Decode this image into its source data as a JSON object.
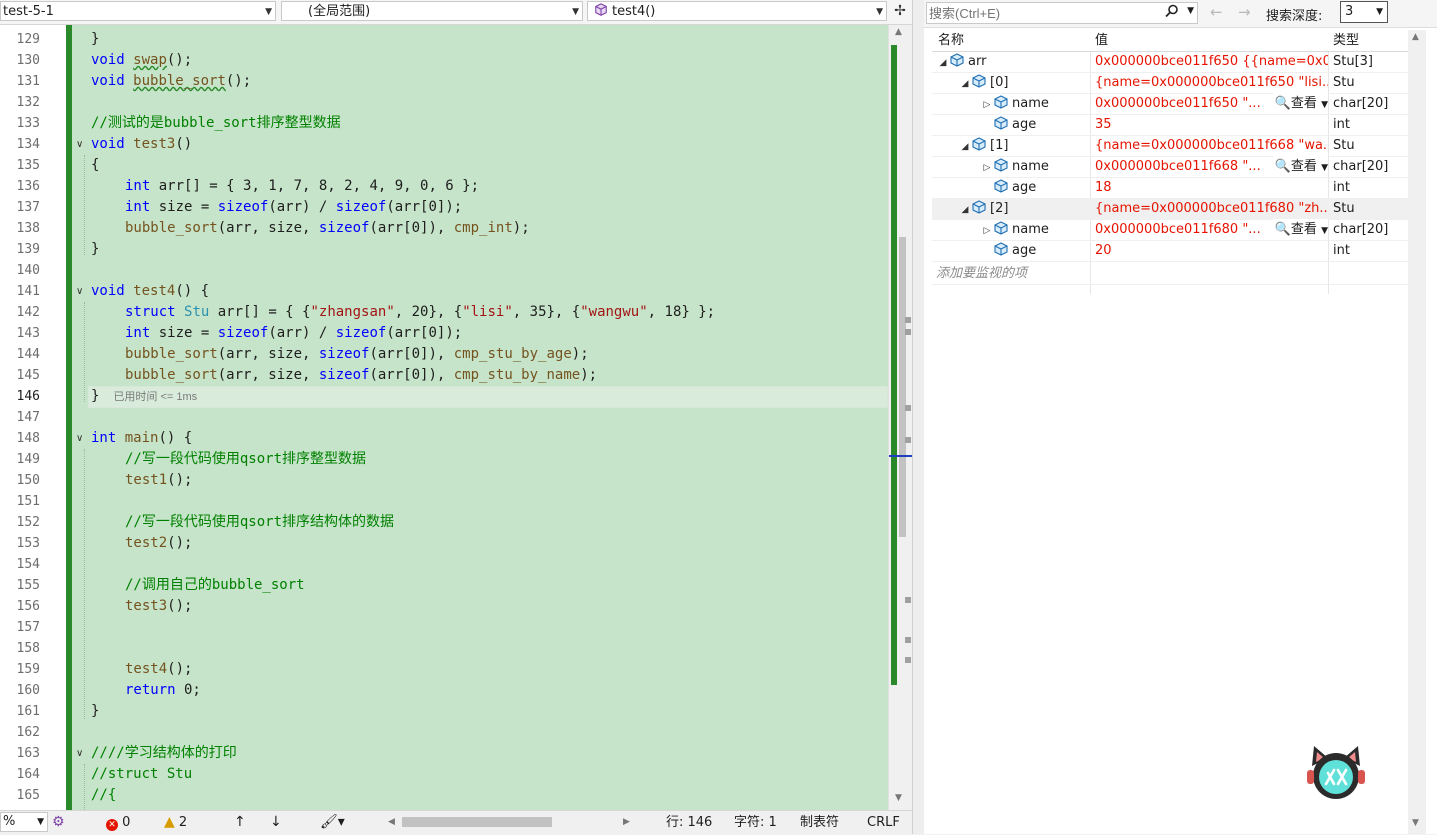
{
  "topbar": {
    "project": "test-5-1",
    "scope": "(全局范围)",
    "function": "test4()"
  },
  "editor": {
    "lines": [
      {
        "n": "129"
      },
      {
        "n": "130"
      },
      {
        "n": "131"
      },
      {
        "n": "132"
      },
      {
        "n": "133"
      },
      {
        "n": "134"
      },
      {
        "n": "135"
      },
      {
        "n": "136"
      },
      {
        "n": "137"
      },
      {
        "n": "138"
      },
      {
        "n": "139"
      },
      {
        "n": "140"
      },
      {
        "n": "141"
      },
      {
        "n": "142"
      },
      {
        "n": "143"
      },
      {
        "n": "144"
      },
      {
        "n": "145"
      },
      {
        "n": "146"
      },
      {
        "n": "147"
      },
      {
        "n": "148"
      },
      {
        "n": "149"
      },
      {
        "n": "150"
      },
      {
        "n": "151"
      },
      {
        "n": "152"
      },
      {
        "n": "153"
      },
      {
        "n": "154"
      },
      {
        "n": "155"
      },
      {
        "n": "156"
      },
      {
        "n": "157"
      },
      {
        "n": "158"
      },
      {
        "n": "159"
      },
      {
        "n": "160"
      },
      {
        "n": "161"
      },
      {
        "n": "162"
      },
      {
        "n": "163"
      },
      {
        "n": "164"
      },
      {
        "n": "165"
      }
    ],
    "current_line": "146",
    "elapsed_hint": "已用时间 <= 1ms",
    "code": {
      "l129": "}",
      "l130_kw": "void",
      "l130_fn": "swap",
      "l130_rest": "();",
      "l131_kw": "void",
      "l131_fn": "bubble_sort",
      "l131_rest": "();",
      "l133": "//测试的是bubble_sort排序整型数据",
      "l134_kw": "void",
      "l134_fn": "test3",
      "l134_rest": "()",
      "l135": "{",
      "l136_kw": "int",
      "l136_rest": " arr[] = { 3, 1, 7, 8, 2, 4, 9, 0, 6 };",
      "l137_kw": "int",
      "l137_a": " size = ",
      "l137_s1": "sizeof",
      "l137_b": "(arr) / ",
      "l137_s2": "sizeof",
      "l137_c": "(arr[0]);",
      "l138_fn": "bubble_sort",
      "l138_a": "(arr, size, ",
      "l138_s": "sizeof",
      "l138_b": "(arr[0]), ",
      "l138_fn2": "cmp_int",
      "l138_c": ");",
      "l139": "}",
      "l141_kw": "void",
      "l141_fn": "test4",
      "l141_rest": "() {",
      "l142_kw": "struct",
      "l142_ty": "Stu",
      "l142_a": " arr[] = { {",
      "l142_s1": "\"zhangsan\"",
      "l142_b": ", 20}, {",
      "l142_s2": "\"lisi\"",
      "l142_c": ", 35}, {",
      "l142_s3": "\"wangwu\"",
      "l142_d": ", 18} };",
      "l143_kw": "int",
      "l143_a": " size = ",
      "l143_s1": "sizeof",
      "l143_b": "(arr) / ",
      "l143_s2": "sizeof",
      "l143_c": "(arr[0]);",
      "l144_fn": "bubble_sort",
      "l144_a": "(arr, size, ",
      "l144_s": "sizeof",
      "l144_b": "(arr[0]), ",
      "l144_fn2": "cmp_stu_by_age",
      "l144_c": ");",
      "l145_fn": "bubble_sort",
      "l145_a": "(arr, size, ",
      "l145_s": "sizeof",
      "l145_b": "(arr[0]), ",
      "l145_fn2": "cmp_stu_by_name",
      "l145_c": ");",
      "l146": "}",
      "l148_kw": "int",
      "l148_fn": "main",
      "l148_rest": "() {",
      "l149": "//写一段代码使用qsort排序整型数据",
      "l150_fn": "test1",
      "l150_rest": "();",
      "l152": "//写一段代码使用qsort排序结构体的数据",
      "l153_fn": "test2",
      "l153_rest": "();",
      "l155": "//调用自己的bubble_sort",
      "l156_fn": "test3",
      "l156_rest": "();",
      "l159_fn": "test4",
      "l159_rest": "();",
      "l160_kw": "return",
      "l160_rest": " 0;",
      "l161": "}",
      "l163": "////学习结构体的打印",
      "l164": "//struct Stu",
      "l165": "//{"
    }
  },
  "statusbar": {
    "zoom": "%",
    "errors": "0",
    "warnings": "2",
    "line": "行: 146",
    "char": "字符: 1",
    "tab": "制表符",
    "eol": "CRLF"
  },
  "watch": {
    "search_placeholder": "搜索(Ctrl+E)",
    "depth_label": "搜索深度:",
    "depth_value": "3",
    "columns": {
      "name": "名称",
      "value": "值",
      "type": "类型"
    },
    "view_label": "查看",
    "rows": [
      {
        "name": "arr",
        "value": "0x000000bce011f650 {{name=0x0...",
        "type": "Stu[3]"
      },
      {
        "name": "[0]",
        "value": "{name=0x000000bce011f650 \"lisi...",
        "type": "Stu"
      },
      {
        "name": "name",
        "value": "0x000000bce011f650 \"...",
        "type": "char[20]"
      },
      {
        "name": "age",
        "value": "35",
        "type": "int"
      },
      {
        "name": "[1]",
        "value": "{name=0x000000bce011f668 \"wa...",
        "type": "Stu"
      },
      {
        "name": "name",
        "value": "0x000000bce011f668 \"...",
        "type": "char[20]"
      },
      {
        "name": "age",
        "value": "18",
        "type": "int"
      },
      {
        "name": "[2]",
        "value": "{name=0x000000bce011f680 \"zh...",
        "type": "Stu"
      },
      {
        "name": "name",
        "value": "0x000000bce011f680 \"...",
        "type": "char[20]"
      },
      {
        "name": "age",
        "value": "20",
        "type": "int"
      }
    ],
    "add_watch": "添加要监视的项"
  },
  "colors": {
    "code_bg": "#c6e4c9",
    "change_bar": "#2a8a2a",
    "value_red": "#e51400",
    "keyword": "#0000ff",
    "comment": "#008000",
    "string": "#a31515"
  },
  "icons": [
    "cube-icon",
    "search-icon",
    "chevron-down-icon",
    "expand-arrow-icon",
    "error-icon",
    "warning-icon",
    "arrow-up-icon",
    "arrow-down-icon",
    "brush-icon",
    "magnify-icon",
    "logo-icon"
  ]
}
